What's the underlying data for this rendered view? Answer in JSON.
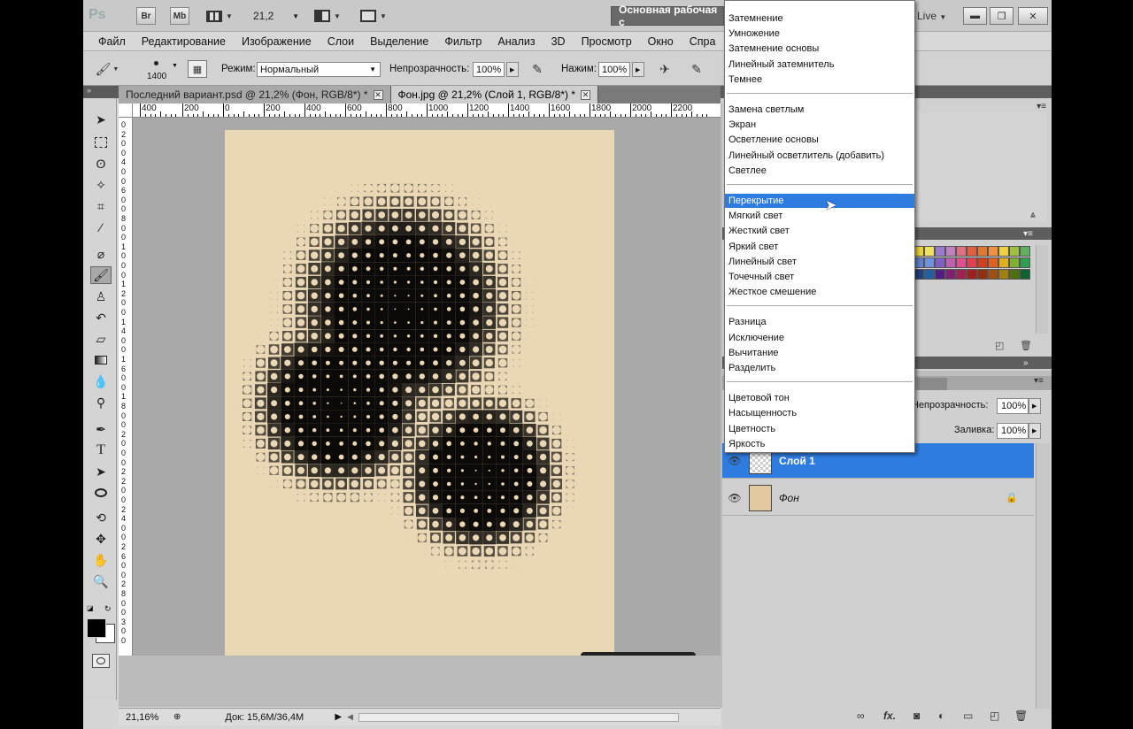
{
  "titlebar": {
    "app_logo": "Ps",
    "btn_br": "Br",
    "btn_mb": "Mb",
    "zoom": "21,2",
    "workspace": "Основная рабочая с",
    "live": "Live"
  },
  "menubar": [
    "Файл",
    "Редактирование",
    "Изображение",
    "Слои",
    "Выделение",
    "Фильтр",
    "Анализ",
    "3D",
    "Просмотр",
    "Окно",
    "Спра"
  ],
  "options": {
    "brush_size": "1400",
    "mode_label": "Режим:",
    "mode_value": "Нормальный",
    "opacity_label": "Непрозрачность:",
    "opacity_value": "100%",
    "pressure_label": "Нажим:",
    "pressure_value": "100%"
  },
  "doc_tabs": [
    {
      "label": "Последний вариант.psd @ 21,2% (Фон, RGB/8*) *",
      "active": false
    },
    {
      "label": "Фон.jpg @ 21,2% (Слой 1, RGB/8*) *",
      "active": true
    }
  ],
  "ruler_h": [
    "400",
    "200",
    "0",
    "200",
    "400",
    "600",
    "800",
    "1000",
    "1200",
    "1400",
    "1600",
    "1800",
    "2000",
    "2200"
  ],
  "ruler_v": [
    "0",
    "2",
    "0",
    "0",
    "4",
    "0",
    "0",
    "6",
    "0",
    "0",
    "8",
    "0",
    "0",
    "1",
    "0",
    "0",
    "0",
    "1",
    "2",
    "0",
    "0",
    "1",
    "4",
    "0",
    "0",
    "1",
    "6",
    "0",
    "0",
    "1",
    "8",
    "0",
    "0",
    "2",
    "0",
    "0",
    "0",
    "2",
    "2",
    "0",
    "0",
    "2",
    "4",
    "0",
    "0",
    "2",
    "6",
    "0",
    "0",
    "2",
    "8",
    "0",
    "0",
    "3",
    "0",
    "0"
  ],
  "statusbar": {
    "zoom": "21,16%",
    "doc": "Док: 15,6M/36,4M"
  },
  "blend_menu": {
    "groups": [
      [
        "Затемнение",
        "Умножение",
        "Затемнение основы",
        "Линейный затемнитель",
        "Темнее"
      ],
      [
        "Замена светлым",
        "Экран",
        "Осветление основы",
        "Линейный осветлитель (добавить)",
        "Светлее"
      ],
      [
        "Перекрытие",
        "Мягкий свет",
        "Жесткий свет",
        "Яркий свет",
        "Линейный свет",
        "Точечный свет",
        "Жесткое смешение"
      ],
      [
        "Разница",
        "Исключение",
        "Вычитание",
        "Разделить"
      ],
      [
        "Цветовой тон",
        "Насыщенность",
        "Цветность",
        "Яркость"
      ]
    ],
    "highlighted": "Перекрытие"
  },
  "layers_panel": {
    "opacity_label": "Непрозрачность:",
    "opacity_value": "100%",
    "fill_label": "Заливка:",
    "fill_value": "100%",
    "layers": [
      {
        "name": "Слой 1",
        "selected": true
      },
      {
        "name": "Фон",
        "selected": false,
        "locked": true
      }
    ]
  },
  "colors": {
    "selection_blue": "#2f7ce0",
    "paper": "#ead7b5",
    "ink": "#0c0a08"
  },
  "swatch_colors": [
    "#e8d23a",
    "#f0e060",
    "#9a7bd0",
    "#c080c0",
    "#e07080",
    "#e06040",
    "#e07830",
    "#f09040",
    "#f0d040",
    "#a0c040",
    "#60b060",
    "#6080d0",
    "#7090e0",
    "#8060c0",
    "#c060b0",
    "#e05090",
    "#e04050",
    "#d04020",
    "#e06020",
    "#e0b020",
    "#80b030",
    "#30a050",
    "#204080",
    "#2060a0",
    "#502080",
    "#802070",
    "#a02050",
    "#a02020",
    "#903010",
    "#a05010",
    "#a08010",
    "#507010",
    "#106030"
  ]
}
